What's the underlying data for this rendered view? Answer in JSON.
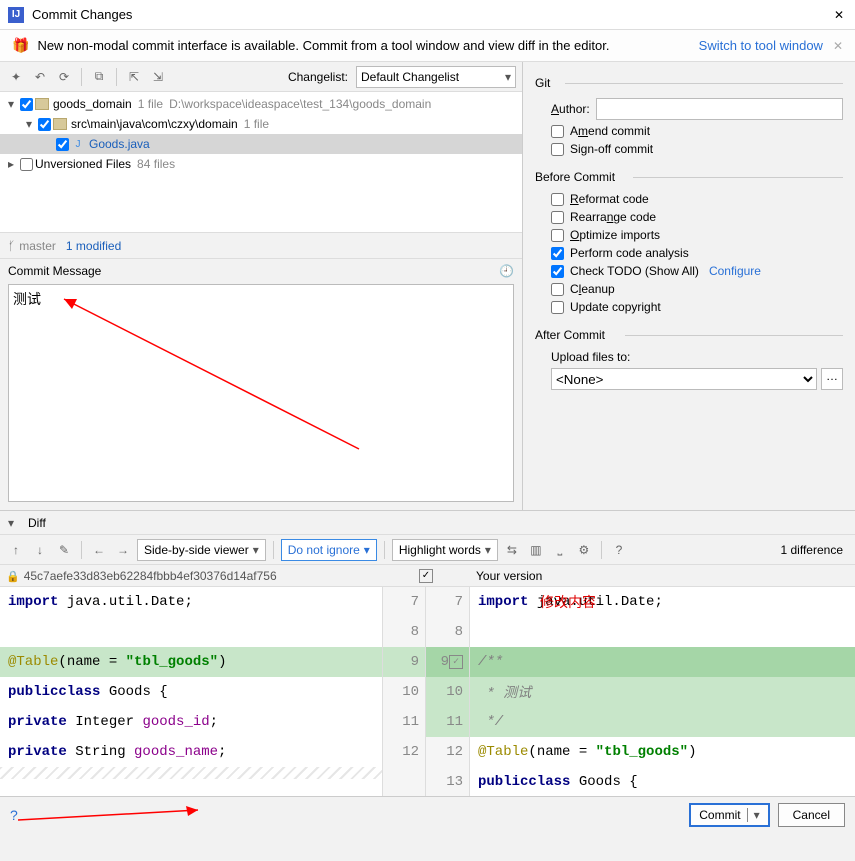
{
  "window": {
    "title": "Commit Changes"
  },
  "banner": {
    "msg": "New non-modal commit interface is available. Commit from a tool window and view diff in the editor.",
    "link": "Switch to tool window"
  },
  "toolbar": {
    "changelist_label": "Changelist:",
    "changelist_value": "Default Changelist"
  },
  "tree": {
    "root": {
      "name": "goods_domain",
      "files": "1 file",
      "path": "D:\\workspace\\ideaspace\\test_134\\goods_domain"
    },
    "pkg": {
      "name": "src\\main\\java\\com\\czxy\\domain",
      "files": "1 file"
    },
    "file": {
      "name": "Goods.java"
    },
    "unv": {
      "name": "Unversioned Files",
      "count": "84 files"
    }
  },
  "branch": {
    "name": "master",
    "modified": "1 modified"
  },
  "commit_msg": {
    "header": "Commit Message",
    "value": "测试"
  },
  "git": {
    "title": "Git",
    "author_label": "Author:",
    "author_value": "",
    "amend": "Amend commit",
    "signoff": "Sign-off commit"
  },
  "before": {
    "title": "Before Commit",
    "reformat": "Reformat code",
    "rearrange": "Rearrange code",
    "optimize": "Optimize imports",
    "analysis": "Perform code analysis",
    "todo": "Check TODO (Show All)",
    "configure": "Configure",
    "cleanup": "Cleanup",
    "copyright": "Update copyright"
  },
  "after": {
    "title": "After Commit",
    "upload_label": "Upload files to:",
    "upload_value": "<None>"
  },
  "diff": {
    "header": "Diff",
    "view_mode": "Side-by-side viewer",
    "ignore": "Do not ignore",
    "highlight": "Highlight words",
    "count": "1 difference",
    "left_title": "45c7aefe33d83eb62284fbbb4ef30376d14af756",
    "right_title": "Your version",
    "annotation": "修改内容"
  },
  "code": {
    "left": [
      {
        "n": 7,
        "html": "<span class='kw'>import</span> java.util.Date;"
      },
      {
        "n": 8,
        "html": ""
      },
      {
        "n": 9,
        "html": "<span class='ann'>@Table</span>(name = <span class='str'>\"tbl_goods\"</span>)",
        "cls": "hl-green"
      },
      {
        "n": 10,
        "html": "<span class='kw'>public</span> <span class='kw'>class</span> Goods {"
      },
      {
        "n": 11,
        "html": "    <span class='kw'>private</span> Integer <span class='fld'>goods_id</span>;"
      },
      {
        "n": 12,
        "html": "    <span class='kw'>private</span> String <span class='fld'>goods_name</span>;"
      }
    ],
    "right": [
      {
        "n": 7,
        "html": "<span class='kw'>import</span> java.util.Date;"
      },
      {
        "n": 8,
        "html": ""
      },
      {
        "n": 9,
        "html": "<span class='cmt'>/**</span>",
        "cls": "hl-green-dark"
      },
      {
        "n": 10,
        "html": "<span class='cmt'> * 测试</span>",
        "cls": "hl-green"
      },
      {
        "n": 11,
        "html": "<span class='cmt'> */</span>",
        "cls": "hl-green"
      },
      {
        "n": 12,
        "html": "<span class='ann'>@Table</span>(name = <span class='str'>\"tbl_goods\"</span>)"
      },
      {
        "n": 13,
        "html": "<span class='kw'>public</span> <span class='kw'>class</span> Goods {"
      }
    ]
  },
  "footer": {
    "commit": "Commit",
    "cancel": "Cancel"
  }
}
